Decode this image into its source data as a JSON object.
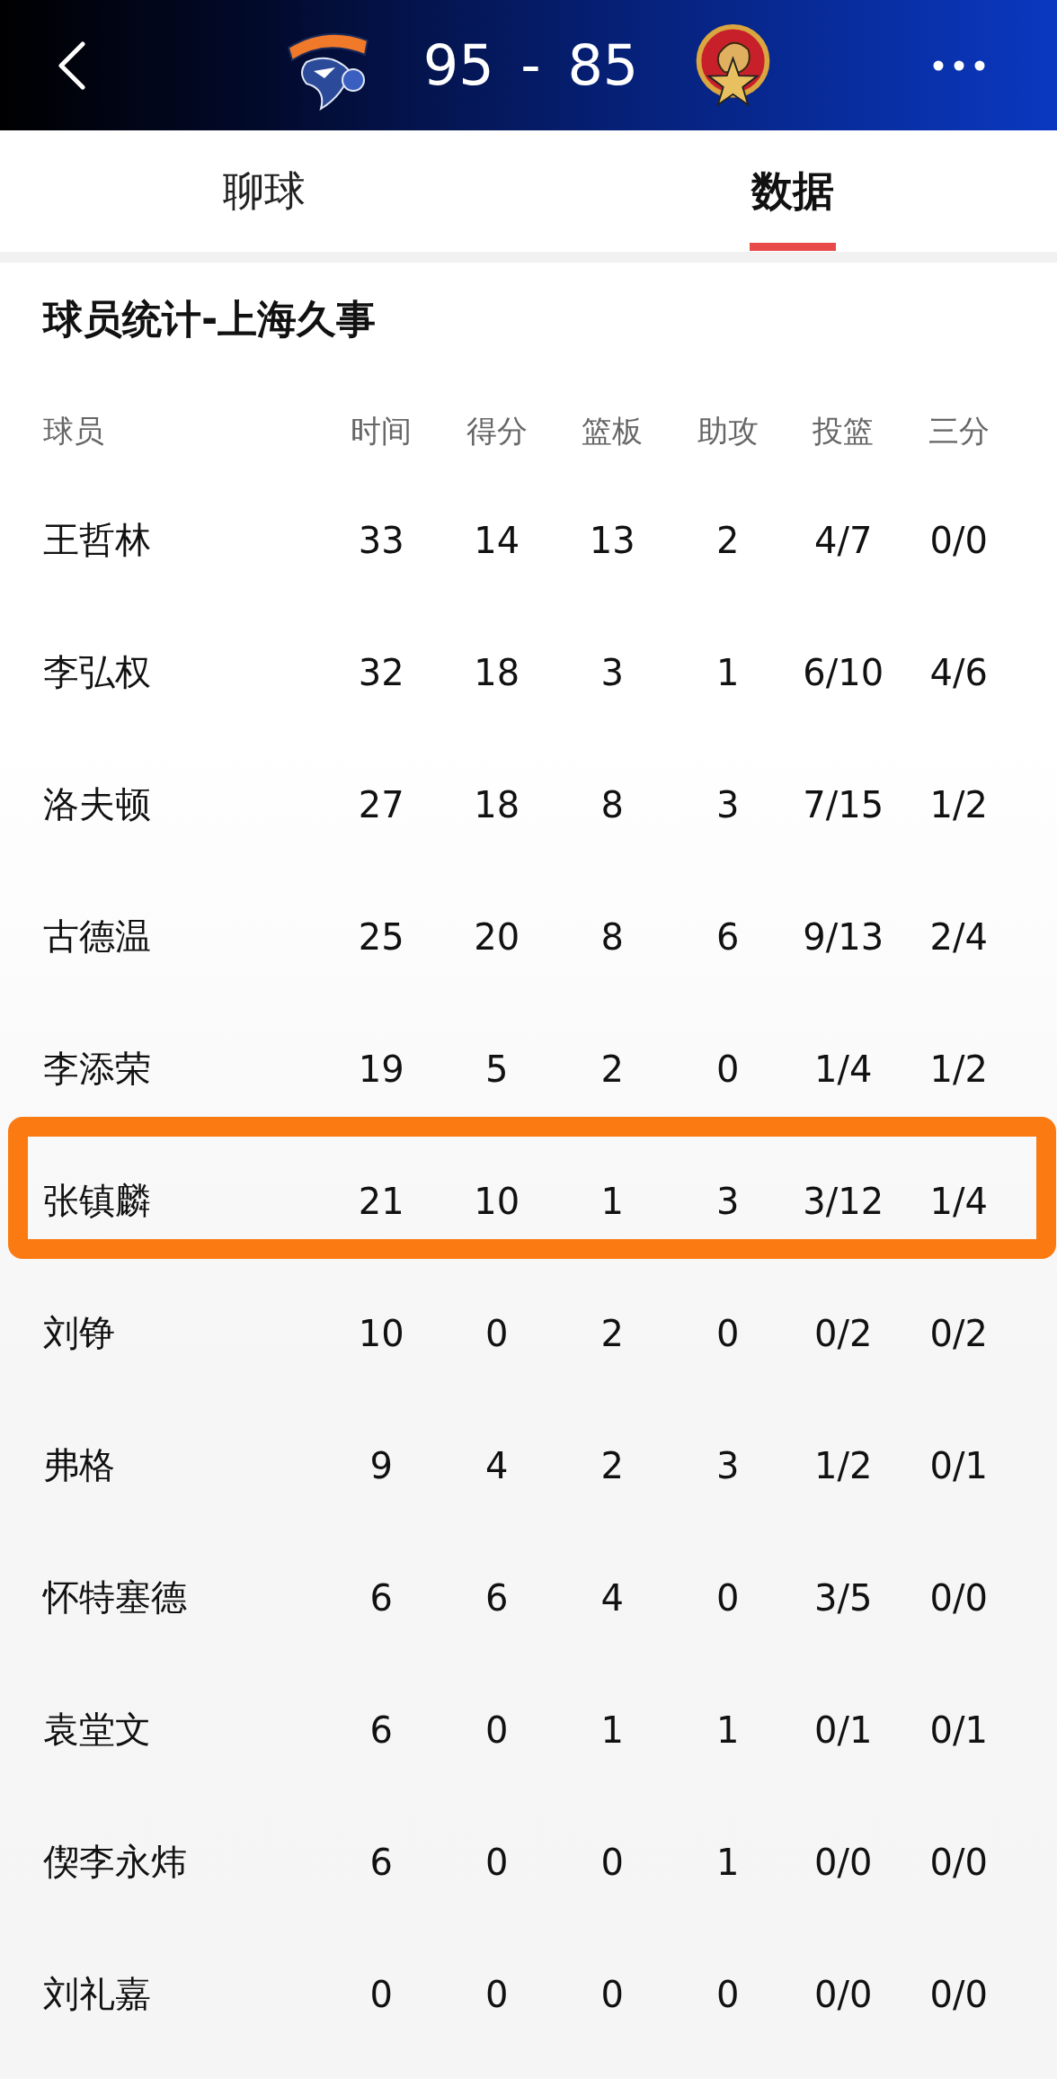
{
  "header": {
    "score": "95 - 85"
  },
  "tabs": [
    {
      "label": "聊球",
      "selected": false
    },
    {
      "label": "数据",
      "selected": true
    }
  ],
  "section_title": "球员统计-上海久事",
  "table": {
    "columns": [
      "球员",
      "时间",
      "得分",
      "篮板",
      "助攻",
      "投篮",
      "三分"
    ],
    "rows": [
      {
        "cells": [
          "王哲林",
          "33",
          "14",
          "13",
          "2",
          "4/7",
          "0/0"
        ],
        "highlighted": false
      },
      {
        "cells": [
          "李弘权",
          "32",
          "18",
          "3",
          "1",
          "6/10",
          "4/6"
        ],
        "highlighted": false
      },
      {
        "cells": [
          "洛夫顿",
          "27",
          "18",
          "8",
          "3",
          "7/15",
          "1/2"
        ],
        "highlighted": false
      },
      {
        "cells": [
          "古德温",
          "25",
          "20",
          "8",
          "6",
          "9/13",
          "2/4"
        ],
        "highlighted": false
      },
      {
        "cells": [
          "李添荣",
          "19",
          "5",
          "2",
          "0",
          "1/4",
          "1/2"
        ],
        "highlighted": false
      },
      {
        "cells": [
          "张镇麟",
          "21",
          "10",
          "1",
          "3",
          "3/12",
          "1/4"
        ],
        "highlighted": true
      },
      {
        "cells": [
          "刘铮",
          "10",
          "0",
          "2",
          "0",
          "0/2",
          "0/2"
        ],
        "highlighted": false
      },
      {
        "cells": [
          "弗格",
          "9",
          "4",
          "2",
          "3",
          "1/2",
          "0/1"
        ],
        "highlighted": false
      },
      {
        "cells": [
          "怀特塞德",
          "6",
          "6",
          "4",
          "0",
          "3/5",
          "0/0"
        ],
        "highlighted": false
      },
      {
        "cells": [
          "袁堂文",
          "6",
          "0",
          "1",
          "1",
          "0/1",
          "0/1"
        ],
        "highlighted": false
      },
      {
        "cells": [
          "偰李永炜",
          "6",
          "0",
          "0",
          "1",
          "0/0",
          "0/0"
        ],
        "highlighted": false
      },
      {
        "cells": [
          "刘礼嘉",
          "0",
          "0",
          "0",
          "0",
          "0/0",
          "0/0"
        ],
        "highlighted": false
      }
    ]
  }
}
